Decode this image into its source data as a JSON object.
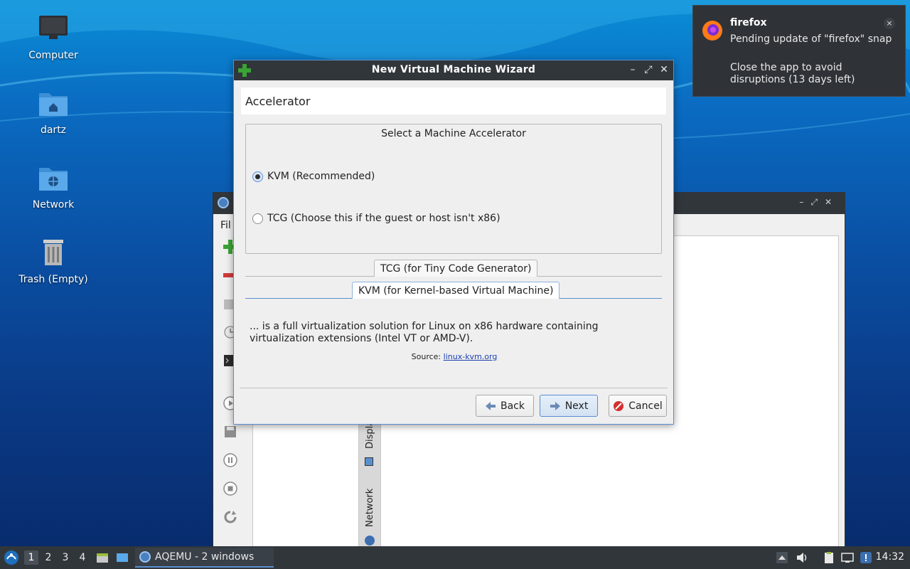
{
  "desktop": {
    "icons": [
      {
        "label": "Computer"
      },
      {
        "label": "dartz"
      },
      {
        "label": "Network"
      },
      {
        "label": "Trash (Empty)"
      }
    ]
  },
  "background_window": {
    "menu_label": "Fil",
    "vtab_display": "Displa",
    "vtab_network": "Network"
  },
  "wizard": {
    "title": "New Virtual Machine Wizard",
    "page_title": "Accelerator",
    "group_title": "Select a Machine Accelerator",
    "options": [
      {
        "label": "KVM (Recommended)",
        "checked": true
      },
      {
        "label": "TCG (Choose this if the guest or host isn't x86)",
        "checked": false
      }
    ],
    "tab_tcg": "TCG (for Tiny Code Generator)",
    "tab_kvm": "KVM (for Kernel-based Virtual Machine)",
    "description": "... is a full virtualization solution for Linux on x86 hardware containing virtualization extensions (Intel VT or AMD-V).",
    "source_prefix": "Source:",
    "source_link": "linux-kvm.org",
    "buttons": {
      "back": "Back",
      "next": "Next",
      "cancel": "Cancel"
    }
  },
  "notification": {
    "app": "firefox",
    "line1": "Pending update of \"firefox\" snap",
    "line2": "Close the app to avoid disruptions (13 days left)",
    "close": "×"
  },
  "taskbar": {
    "workspaces": [
      "1",
      "2",
      "3",
      "4"
    ],
    "task_label": "AQEMU - 2 windows",
    "clock": "14:32"
  }
}
